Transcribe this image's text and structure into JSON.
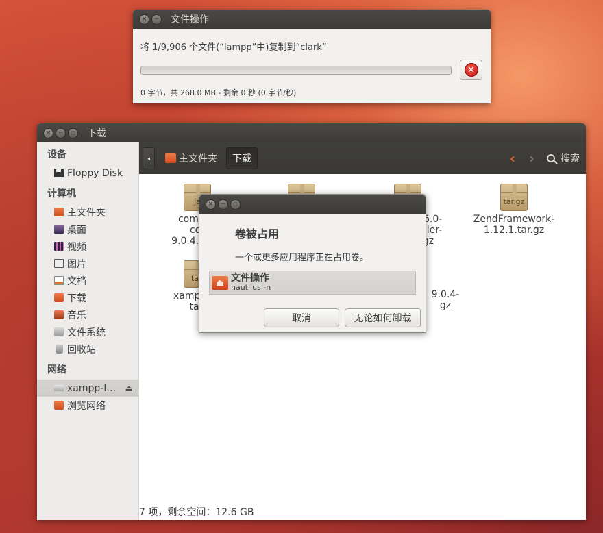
{
  "copy_dialog": {
    "title": "文件操作",
    "status": "将 1/9,906 个文件(“lampp”中)复制到“clark”",
    "progress_fraction": 0,
    "detail": "0 字节，共 268.0 MB - 剩余 0 秒 (0 字节/秒)"
  },
  "files_window": {
    "title": "下载",
    "sidebar": {
      "devices_heading": "设备",
      "devices": [
        {
          "label": "Floppy Disk",
          "icon": "floppy-icon"
        }
      ],
      "computer_heading": "计算机",
      "computer": [
        {
          "label": "主文件夹",
          "icon": "home-folder-icon"
        },
        {
          "label": "桌面",
          "icon": "desktop-icon"
        },
        {
          "label": "视频",
          "icon": "video-icon"
        },
        {
          "label": "图片",
          "icon": "pictures-icon"
        },
        {
          "label": "文档",
          "icon": "documents-icon"
        },
        {
          "label": "下载",
          "icon": "download-folder-icon"
        },
        {
          "label": "音乐",
          "icon": "music-icon"
        },
        {
          "label": "文件系统",
          "icon": "filesystem-icon"
        },
        {
          "label": "回收站",
          "icon": "trash-icon"
        }
      ],
      "network_heading": "网络",
      "network": [
        {
          "label": "xampp-l…",
          "icon": "drive-icon",
          "eject": "⏏"
        },
        {
          "label": "浏览网络",
          "icon": "network-icon"
        }
      ]
    },
    "toolbar": {
      "back_glyph": "◂",
      "home_crumb": "主文件夹",
      "current_crumb": "下载",
      "prev_glyph": "‹",
      "next_glyph": "›",
      "search_label": "搜索"
    },
    "files": [
      {
        "badge": "ja",
        "lines": [
          "com.zer",
          "cor",
          "9.0.4.2012"
        ]
      },
      {
        "badge": "",
        "lines": []
      },
      {
        "badge": "",
        "lines": [
          "5.6.0-",
          "taller-",
          "gz"
        ]
      },
      {
        "badge": "tar.gz",
        "lines": [
          "ZendFramework-",
          "1.12.1.tar.gz"
        ]
      },
      {
        "badge": "tar.",
        "lines": [
          "xampp-lin",
          "tar."
        ]
      },
      {
        "badge": "",
        "lines": [
          "9.0.4-",
          "gz"
        ]
      }
    ],
    "status_bar": "7 项，剩余空间：12.6 GB"
  },
  "busy_dialog": {
    "heading": "卷被占用",
    "description": "一个或更多应用程序正在占用卷。",
    "app_name": "文件操作",
    "app_command": "nautilus -n",
    "cancel_label": "取消",
    "force_label": "无论如何卸载"
  },
  "window_buttons": {
    "close": "×",
    "minimize": "−",
    "maximize": "□"
  }
}
